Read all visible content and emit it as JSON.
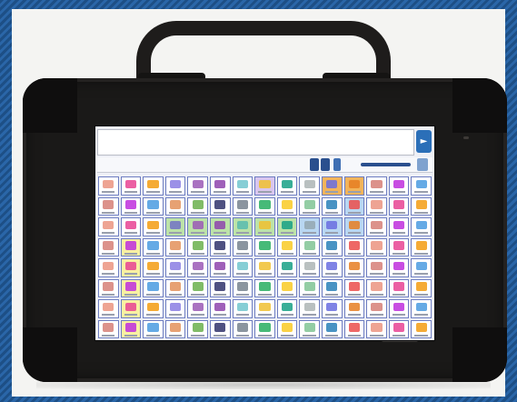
{
  "scene": {
    "subject": "rugged-tablet-aac-device",
    "frame_color": "#1d4f86",
    "device_color": "#1a1918",
    "screen_bg": "#eef0f6",
    "cell_border": "#6d7dc1",
    "accent": "#2b6fb8"
  },
  "screen": {
    "message_bar_text": "",
    "grid_rows": 8,
    "grid_cols": 15,
    "symbol_colors": [
      "#e05a3a",
      "#f0c030",
      "#4a9be0",
      "#3aa45a",
      "#9b59b6",
      "#e67e22",
      "#2c3e50",
      "#e84393",
      "#16a085",
      "#d35400",
      "#2980b9",
      "#8e44ad",
      "#c0392b",
      "#27ae60",
      "#f39c12",
      "#7f8c8d",
      "#6ab04c",
      "#eb4d4b",
      "#22a6b3",
      "#be2edd",
      "#f9ca24",
      "#4834d4",
      "#686de0",
      "#30336b"
    ],
    "highlight_colors": {
      "green": "#bde3a8",
      "yellow": "#f8f1a2",
      "orange": "#f2b45a",
      "blue": "#b9d7f2",
      "pink": "#f3c5d6",
      "purple": "#d9c6ef"
    }
  }
}
